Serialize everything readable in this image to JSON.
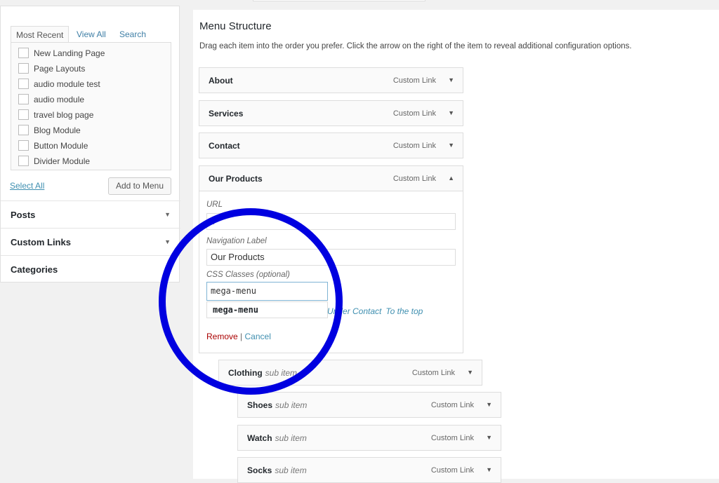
{
  "left": {
    "tabs": [
      "Most Recent",
      "View All",
      "Search"
    ],
    "items": [
      "New Landing Page",
      "Page Layouts",
      "audio module test",
      "audio module",
      "travel blog page",
      "Blog Module",
      "Button Module",
      "Divider Module"
    ],
    "select_all": "Select All",
    "add_to_menu": "Add to Menu",
    "sections": [
      "Posts",
      "Custom Links",
      "Categories"
    ]
  },
  "main": {
    "title": "Menu Structure",
    "description": "Drag each item into the order you prefer. Click the arrow on the right of the item to reveal additional configuration options.",
    "items": [
      {
        "title": "About",
        "type": "Custom Link"
      },
      {
        "title": "Services",
        "type": "Custom Link"
      },
      {
        "title": "Contact",
        "type": "Custom Link"
      },
      {
        "title": "Our Products",
        "type": "Custom Link"
      }
    ],
    "editor": {
      "url_label": "URL",
      "url_value": "#",
      "nav_label": "Navigation Label",
      "nav_value": "Our Products",
      "css_label": "CSS Classes (optional)",
      "css_value": "mega-menu",
      "suggestion": "mega-menu",
      "move_under": "Under Contact",
      "move_top": "To the top",
      "remove": "Remove",
      "separator": "|",
      "cancel": "Cancel"
    },
    "subitems": [
      {
        "title": "Clothing",
        "sub": "sub item",
        "type": "Custom Link"
      },
      {
        "title": "Shoes",
        "sub": "sub item",
        "type": "Custom Link"
      },
      {
        "title": "Watch",
        "sub": "sub item",
        "type": "Custom Link"
      },
      {
        "title": "Socks",
        "sub": "sub item",
        "type": "Custom Link"
      }
    ]
  },
  "annotation_color": "#0000e0"
}
